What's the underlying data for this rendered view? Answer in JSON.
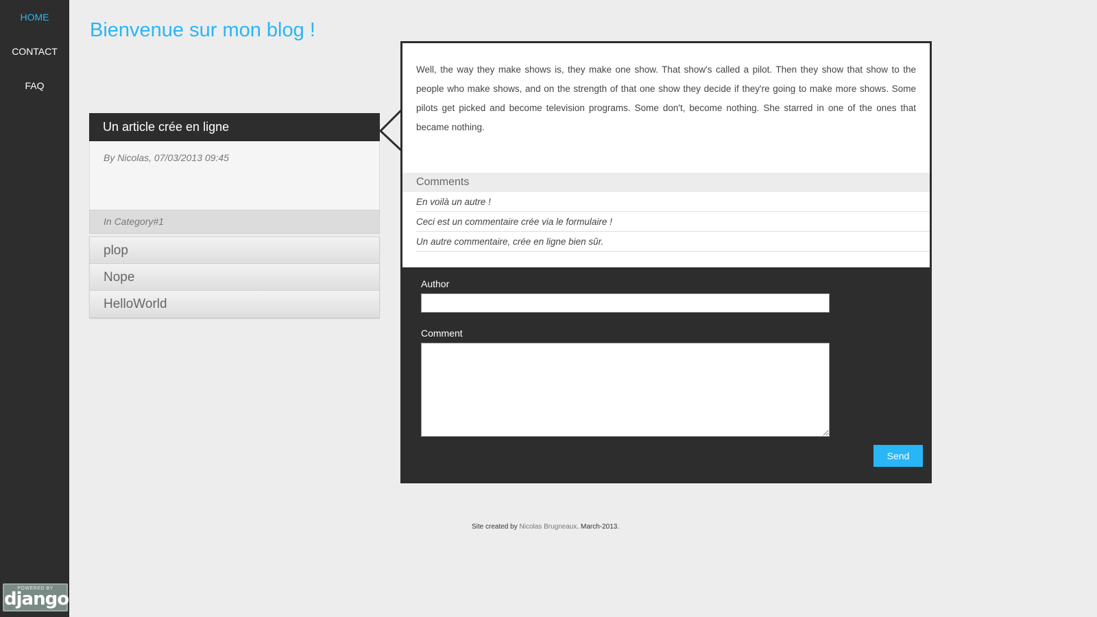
{
  "nav": {
    "items": [
      {
        "label": "HOME"
      },
      {
        "label": "CONTACT"
      },
      {
        "label": "FAQ"
      }
    ]
  },
  "badge": {
    "powered": "POWERED BY",
    "word": "django"
  },
  "page_title": "Bienvenue sur mon blog !",
  "article": {
    "title": "Un article crée en ligne",
    "meta": "By Nicolas, 07/03/2013 09:45",
    "category": "In Category#1",
    "body": "Well, the way they make shows is, they make one show. That show's called a pilot. Then they show that show to the people who make shows, and on the strength of that one show they decide if they're going to make more shows. Some pilots get picked and become television programs. Some don't, become nothing. She starred in one of the ones that became nothing."
  },
  "article_list": [
    {
      "label": "plop"
    },
    {
      "label": "Nope"
    },
    {
      "label": "HelloWorld"
    }
  ],
  "comments": {
    "header": "Comments",
    "items": [
      {
        "text": "En voilà un autre !"
      },
      {
        "text": "Ceci est un commentaire crée via le formulaire !"
      },
      {
        "text": "Un autre commentaire, crée en ligne bien sûr."
      }
    ]
  },
  "form": {
    "author_label": "Author",
    "author_value": "",
    "comment_label": "Comment",
    "comment_value": "",
    "send_label": "Send"
  },
  "footer": {
    "prefix": "Site created by",
    "author": "Nicolas Brugneaux",
    "suffix": ". March-2013."
  },
  "colors": {
    "accent": "#29b6f6",
    "dark": "#2d2d2d",
    "background": "#ededed"
  }
}
